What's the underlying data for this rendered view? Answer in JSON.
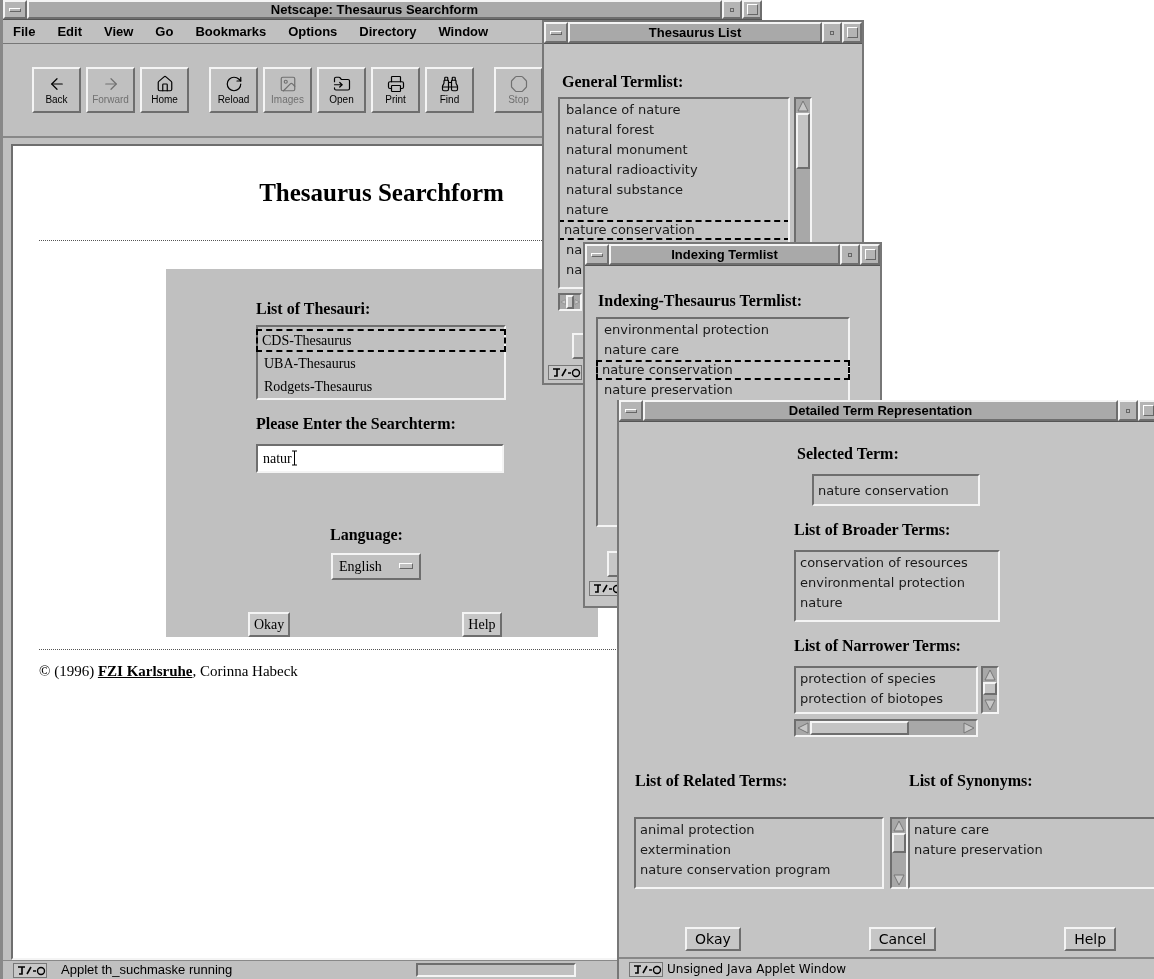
{
  "browser": {
    "title": "Netscape: Thesaurus Searchform",
    "menu": [
      "File",
      "Edit",
      "View",
      "Go",
      "Bookmarks",
      "Options",
      "Directory",
      "Window"
    ],
    "toolbar": [
      {
        "label": "Back",
        "disabled": false
      },
      {
        "label": "Forward",
        "disabled": true
      },
      {
        "label": "Home",
        "disabled": false
      },
      {
        "label": "Reload",
        "disabled": false
      },
      {
        "label": "Images",
        "disabled": true
      },
      {
        "label": "Open",
        "disabled": false
      },
      {
        "label": "Print",
        "disabled": false
      },
      {
        "label": "Find",
        "disabled": false
      },
      {
        "label": "Stop",
        "disabled": true
      }
    ],
    "page": {
      "heading": "Thesaurus Searchform",
      "form": {
        "thesauri_label": "List of Thesauri:",
        "thesauri": [
          {
            "text": "CDS-Thesaurus",
            "selected": true
          },
          {
            "text": "UBA-Thesaurus",
            "selected": false
          },
          {
            "text": "Rodgets-Thesaurus",
            "selected": false
          }
        ],
        "searchterm_label": "Please Enter the Searchterm:",
        "searchterm": "natur",
        "language_label": "Language:",
        "language": "English",
        "buttons": [
          "Okay",
          "Help"
        ]
      },
      "footer": {
        "prefix": "© (1996)",
        "link": "FZI Karlsruhe",
        "suffix": ", Corinna Habeck"
      }
    },
    "status": "Applet th_suchmaske running"
  },
  "thesaurus_list": {
    "title": "Thesaurus List",
    "label": "General Termlist:",
    "items": [
      {
        "text": "balance of nature",
        "selected": false
      },
      {
        "text": "natural forest",
        "selected": false
      },
      {
        "text": "natural monument",
        "selected": false
      },
      {
        "text": "natural radioactivity",
        "selected": false
      },
      {
        "text": "natural substance",
        "selected": false
      },
      {
        "text": "nature",
        "selected": false
      },
      {
        "text": "nature conservation",
        "selected": true
      },
      {
        "text": "na",
        "selected": false
      },
      {
        "text": "na",
        "selected": false
      }
    ]
  },
  "indexing_termlist": {
    "title": "Indexing Termlist",
    "label": "Indexing-Thesaurus Termlist:",
    "items": [
      {
        "text": "environmental protection",
        "selected": false
      },
      {
        "text": "nature care",
        "selected": false
      },
      {
        "text": "nature conservation",
        "selected": true
      },
      {
        "text": "nature preservation",
        "selected": false
      }
    ]
  },
  "detail": {
    "title": "Detailed Term Representation",
    "selected_label": "Selected Term:",
    "selected_term": "nature conservation",
    "broader_label": "List of Broader Terms:",
    "broader": [
      "conservation of resources",
      "environmental protection",
      "nature"
    ],
    "narrower_label": "List of Narrower Terms:",
    "narrower": [
      "protection of species",
      "protection of biotopes"
    ],
    "related_label": "List of Related Terms:",
    "related": [
      "animal protection",
      "extermination",
      "nature conservation program"
    ],
    "synonyms_label": "List of Synonyms:",
    "synonyms": [
      "nature care",
      "nature preservation"
    ],
    "buttons": [
      "Okay",
      "Cancel",
      "Help"
    ],
    "status": "Unsigned Java Applet Window"
  }
}
